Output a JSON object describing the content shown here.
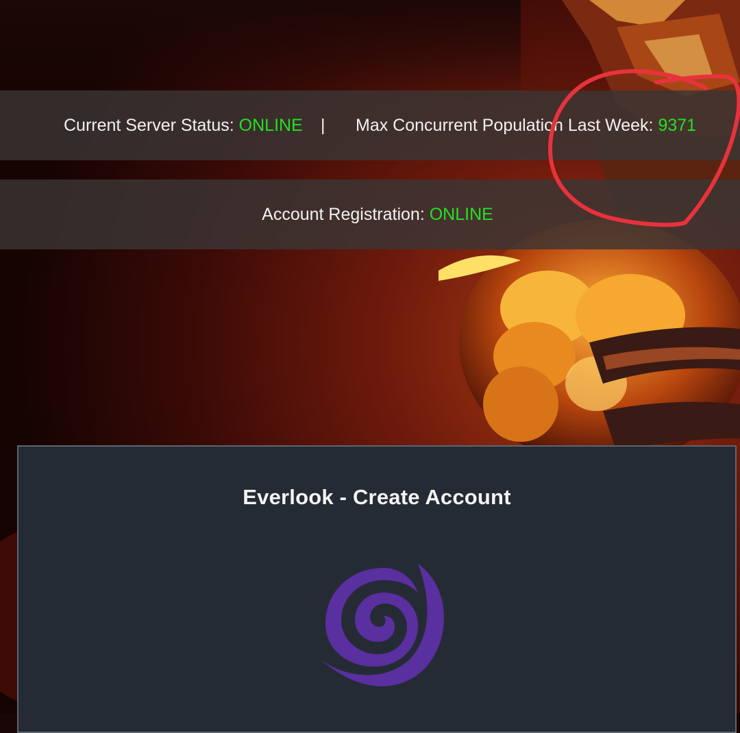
{
  "server_status": {
    "label": "Current Server Status:",
    "value": "ONLINE",
    "separator": "|",
    "population_label": "Max Concurrent Population Last Week:",
    "population_value": "9371"
  },
  "registration_status": {
    "label": "Account Registration:",
    "value": "ONLINE"
  },
  "panel": {
    "title": "Everlook - Create Account",
    "logo_icon": "purple-spiral-logo-icon"
  },
  "colors": {
    "status_online": "#22e222",
    "panel_background": "#252b35",
    "logo_purple": "#5a2fa0",
    "annotation_red": "#e8323c"
  }
}
